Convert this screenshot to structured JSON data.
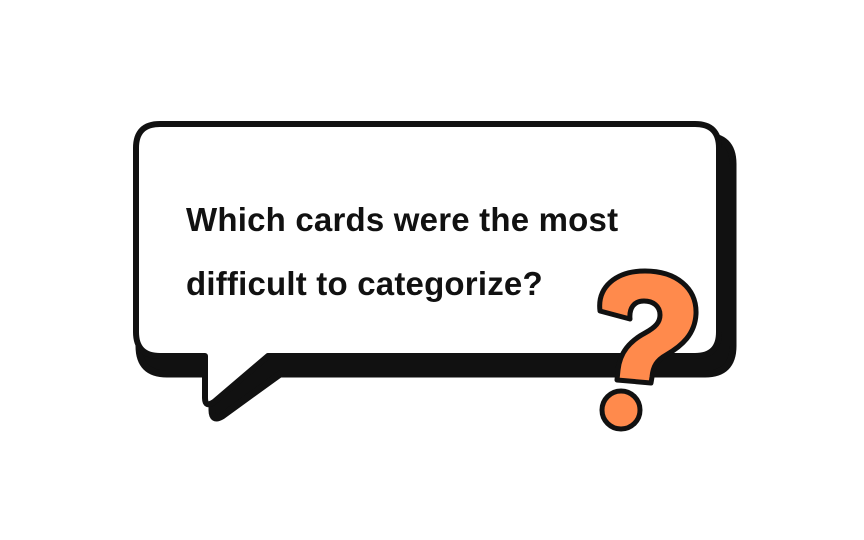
{
  "speech_bubble": {
    "question_line_1": "Which cards were the most",
    "question_line_2": "difficult to categorize?"
  },
  "icons": {
    "speech_bubble": "speech-bubble-icon",
    "question_mark": "question-mark-icon"
  },
  "colors": {
    "background": "#ffffff",
    "bubble_fill": "#ffffff",
    "outline": "#111111",
    "accent": "#FF8A4C",
    "text": "#111111"
  }
}
